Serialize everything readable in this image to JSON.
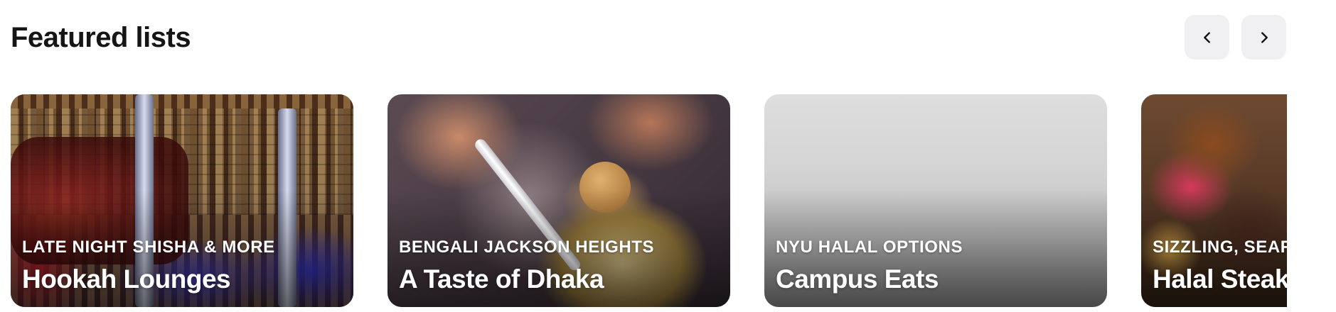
{
  "section": {
    "title": "Featured lists",
    "prev_label": "Previous",
    "next_label": "Next"
  },
  "cards": [
    {
      "subtitle": "LATE NIGHT SHISHA & MORE",
      "title": "Hookah Lounges"
    },
    {
      "subtitle": "BENGALI JACKSON HEIGHTS",
      "title": "A Taste of Dhaka"
    },
    {
      "subtitle": "NYU HALAL OPTIONS",
      "title": "Campus Eats"
    },
    {
      "subtitle": "SIZZLING, SEAR",
      "title": "Halal Steakh"
    }
  ],
  "colors": {
    "nav_button_bg": "#f0eff2",
    "title_text": "#151515",
    "card_text": "#ffffff"
  },
  "icons": {
    "prev": "chevron-left-icon",
    "next": "chevron-right-icon"
  }
}
